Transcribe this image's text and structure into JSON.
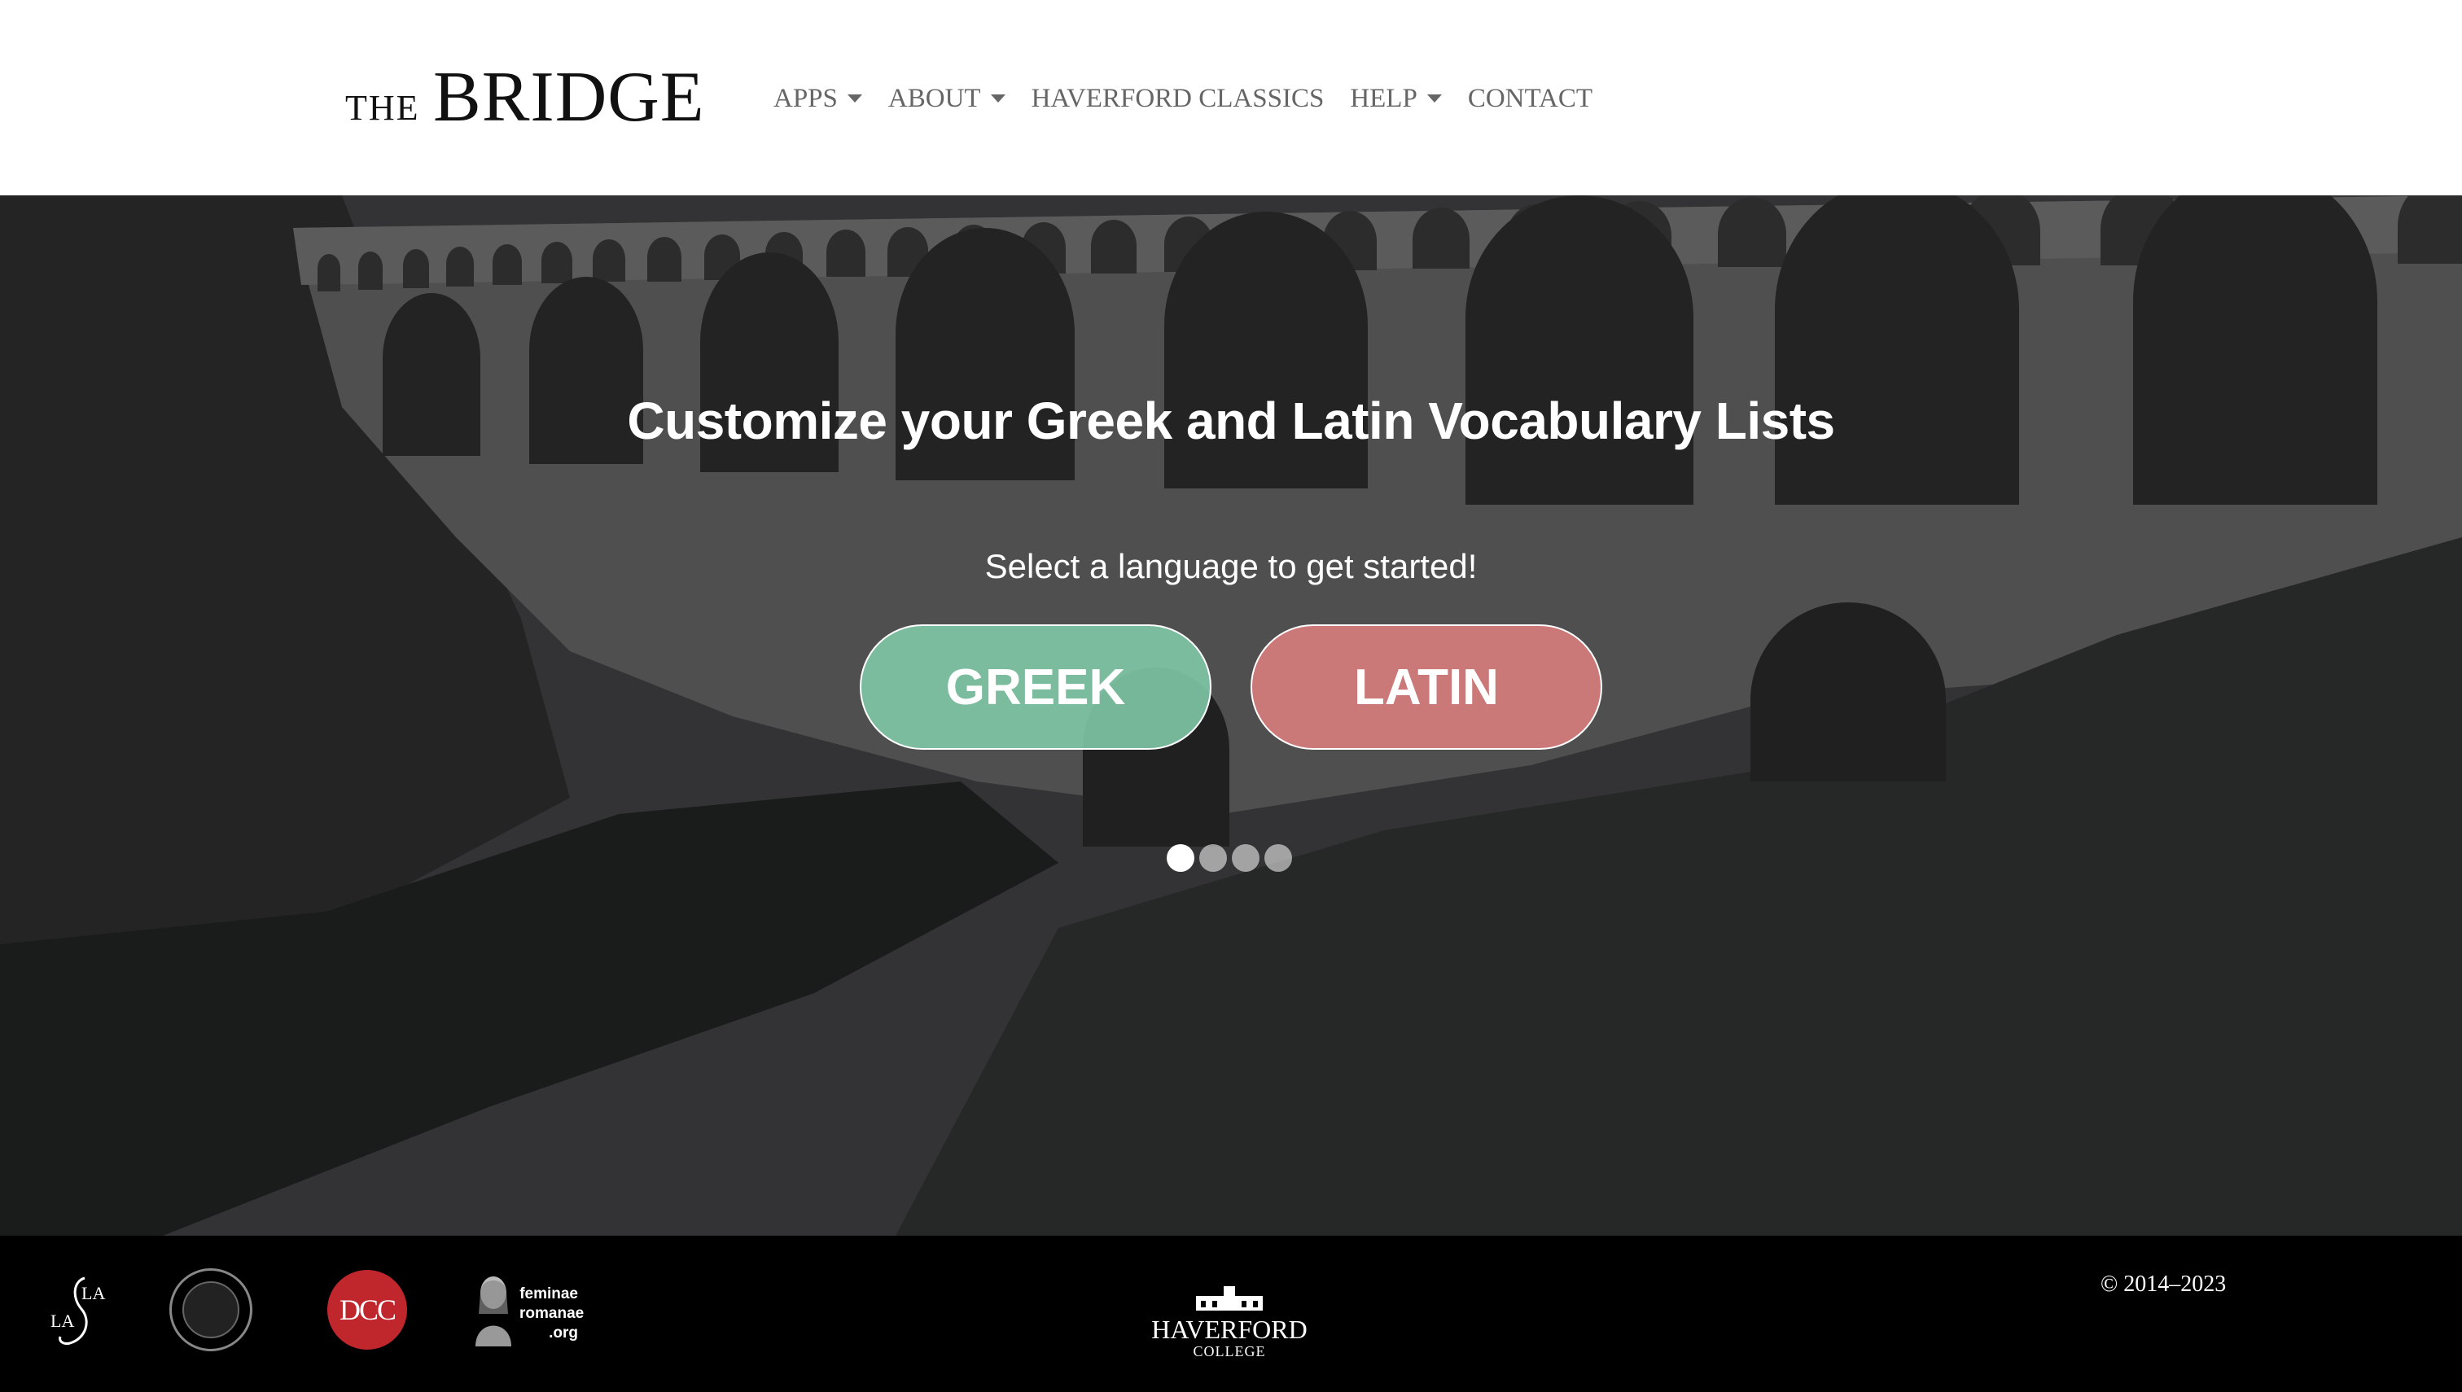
{
  "header": {
    "logo": {
      "small": "THE",
      "large": "BRIDGE"
    },
    "nav": [
      {
        "label": "APPS",
        "has_dropdown": true
      },
      {
        "label": "ABOUT",
        "has_dropdown": true
      },
      {
        "label": "HAVERFORD CLASSICS",
        "has_dropdown": false
      },
      {
        "label": "HELP",
        "has_dropdown": true
      },
      {
        "label": "CONTACT",
        "has_dropdown": false
      }
    ]
  },
  "hero": {
    "title": "Customize your Greek and Latin Vocabulary Lists",
    "subtitle": "Select a language to get started!",
    "buttons": {
      "greek": "GREEK",
      "latin": "LATIN"
    },
    "carousel": {
      "slide_count": 4,
      "active_index": 0
    },
    "colors": {
      "greek": "#7fc7a6",
      "latin": "#d87c7c"
    }
  },
  "footer": {
    "logos": {
      "lasla_text": "LASLA",
      "dcc_text": "DCC",
      "feminae_text": "feminae romanae .org",
      "haverford_name": "HAVERFORD",
      "haverford_sub": "COLLEGE"
    },
    "copyright": "© 2014–2023"
  }
}
